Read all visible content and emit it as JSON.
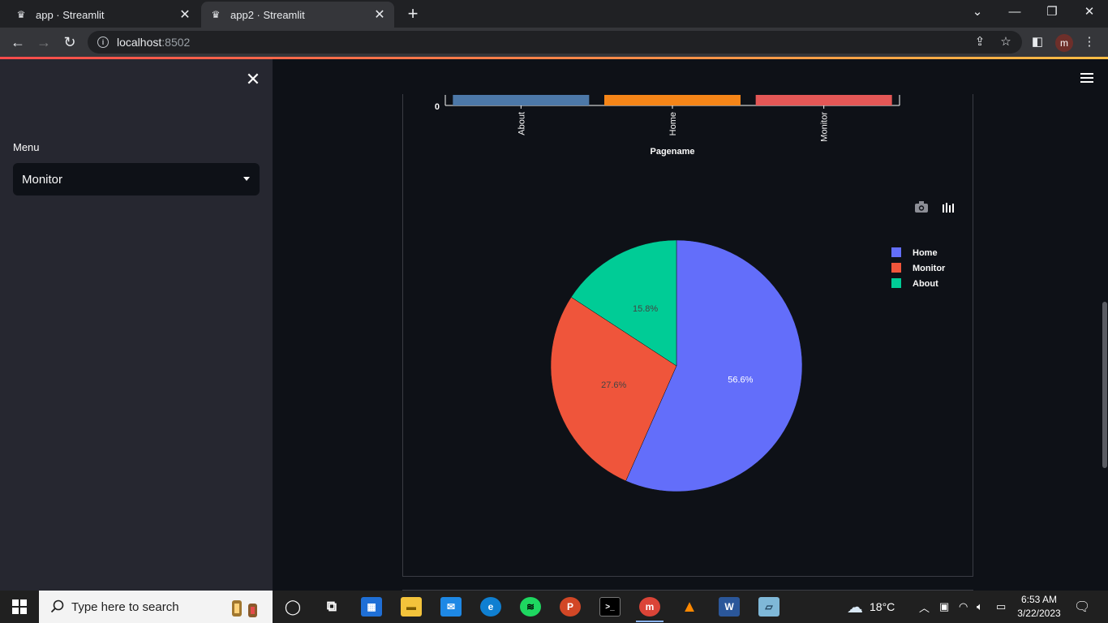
{
  "browser": {
    "tabs": [
      {
        "title": "app · Streamlit"
      },
      {
        "title": "app2 · Streamlit"
      }
    ],
    "url_host": "localhost",
    "url_port": ":8502",
    "profile_initial": "m"
  },
  "sidebar": {
    "menu_label": "Menu",
    "selected": "Monitor"
  },
  "chart_data": [
    {
      "type": "bar",
      "xlabel": "Pagename",
      "categories": [
        "About",
        "Home",
        "Monitor"
      ],
      "visible_y_tick": "0",
      "colors": [
        "#4c78a8",
        "#f58518",
        "#e45756"
      ]
    },
    {
      "type": "pie",
      "labels": [
        "Home",
        "Monitor",
        "About"
      ],
      "values": [
        56.6,
        27.6,
        15.8
      ],
      "text_labels": [
        "56.6%",
        "27.6%",
        "15.8%"
      ],
      "colors": [
        "#636efa",
        "#ef553b",
        "#00cc96"
      ],
      "legend_placement": "top-right",
      "modebar_icons": [
        "camera-icon",
        "plotly-logo-icon"
      ]
    }
  ],
  "taskbar": {
    "search_placeholder": "Type here to search",
    "weather": "18°C",
    "time": "6:53 AM",
    "date": "3/22/2023"
  },
  "colors": {
    "app_bg": "#0e1117",
    "sidebar_bg": "#262730",
    "accent": "#ff4b4b"
  }
}
